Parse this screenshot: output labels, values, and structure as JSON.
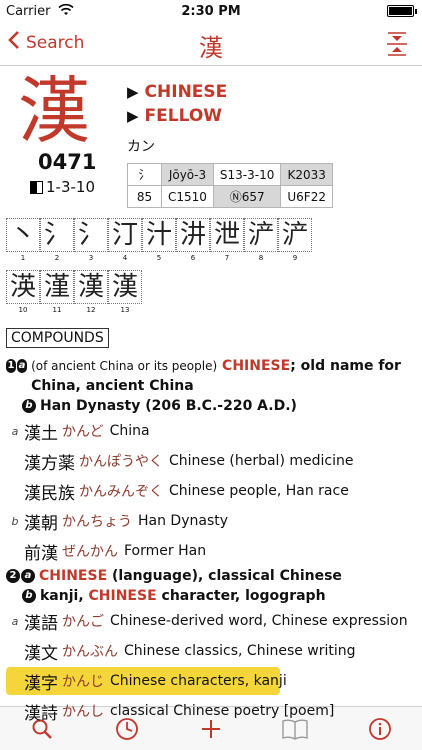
{
  "status": {
    "carrier": "Carrier",
    "time": "2:30 PM"
  },
  "nav": {
    "back_label": "Search",
    "title": "漢"
  },
  "kanji": {
    "character": "漢",
    "number": "0471",
    "code": "1-3-10",
    "meanings": [
      "CHINESE",
      "FELLOW"
    ],
    "reading": "カン"
  },
  "info_table": {
    "radical_glyph": "氵",
    "radical_num": "85",
    "row1": [
      "Jōyō-3",
      "S13-3-10",
      "K2033"
    ],
    "row2": [
      "C1510",
      "Ⓝ657",
      "U6F22"
    ]
  },
  "strokes": {
    "row1": [
      {
        "glyph": "丶",
        "num": "1"
      },
      {
        "glyph": "氵",
        "num": "2"
      },
      {
        "glyph": "氵",
        "num": "3"
      },
      {
        "glyph": "汀",
        "num": "4"
      },
      {
        "glyph": "汁",
        "num": "5"
      },
      {
        "glyph": "汫",
        "num": "6"
      },
      {
        "glyph": "泄",
        "num": "7"
      },
      {
        "glyph": "浐",
        "num": "8"
      },
      {
        "glyph": "浐",
        "num": "9"
      }
    ],
    "row2": [
      {
        "glyph": "渶",
        "num": "10"
      },
      {
        "glyph": "漌",
        "num": "11"
      },
      {
        "glyph": "漢",
        "num": "12"
      },
      {
        "glyph": "漢",
        "num": "13"
      }
    ]
  },
  "compounds_label": "COMPOUNDS",
  "sense1": {
    "num": "1",
    "a_letter": "a",
    "paren": "(of ancient China or its people)",
    "keyword": "CHINESE",
    "rest": "; old name for China, ancient China",
    "b_letter": "b",
    "b_text": "Han Dynasty (206 B.C.-220 A.D.)"
  },
  "compounds1": [
    {
      "label": "a",
      "word": "漢土",
      "kana": "かんど",
      "gloss": "China"
    },
    {
      "label": "",
      "word": "漢方薬",
      "kana": "かんぽうやく",
      "gloss": "Chinese (herbal) medicine"
    },
    {
      "label": "",
      "word": "漢民族",
      "kana": "かんみんぞく",
      "gloss": "Chinese people, Han race"
    },
    {
      "label": "b",
      "word": "漢朝",
      "kana": "かんちょう",
      "gloss": "Han Dynasty"
    },
    {
      "label": "",
      "word": "前漢",
      "kana": "ぜんかん",
      "gloss": "Former Han"
    }
  ],
  "sense2": {
    "num": "2",
    "a_letter": "a",
    "keyword": "CHINESE",
    "rest": " (language), classical Chinese",
    "b_letter": "b",
    "b_pre": "kanji, ",
    "b_keyword": "CHINESE",
    "b_rest": " character, logograph"
  },
  "compounds2": [
    {
      "label": "a",
      "word": "漢語",
      "kana": "かんご",
      "gloss": "Chinese-derived word, Chinese expression"
    },
    {
      "label": "",
      "word": "漢文",
      "kana": "かんぶん",
      "gloss": "Chinese classics, Chinese writing"
    },
    {
      "label": "",
      "word": "漢字",
      "kana": "かんじ",
      "gloss": "Chinese characters, kanji"
    },
    {
      "label": "",
      "word": "漢詩",
      "kana": "かんし",
      "gloss": "classical Chinese poetry [poem]"
    }
  ],
  "colors": {
    "accent": "#c0392b",
    "highlight": "#f4d63a"
  },
  "tabbar": [
    "search-icon",
    "history-clock-icon",
    "add-icon",
    "book-icon",
    "info-icon"
  ]
}
